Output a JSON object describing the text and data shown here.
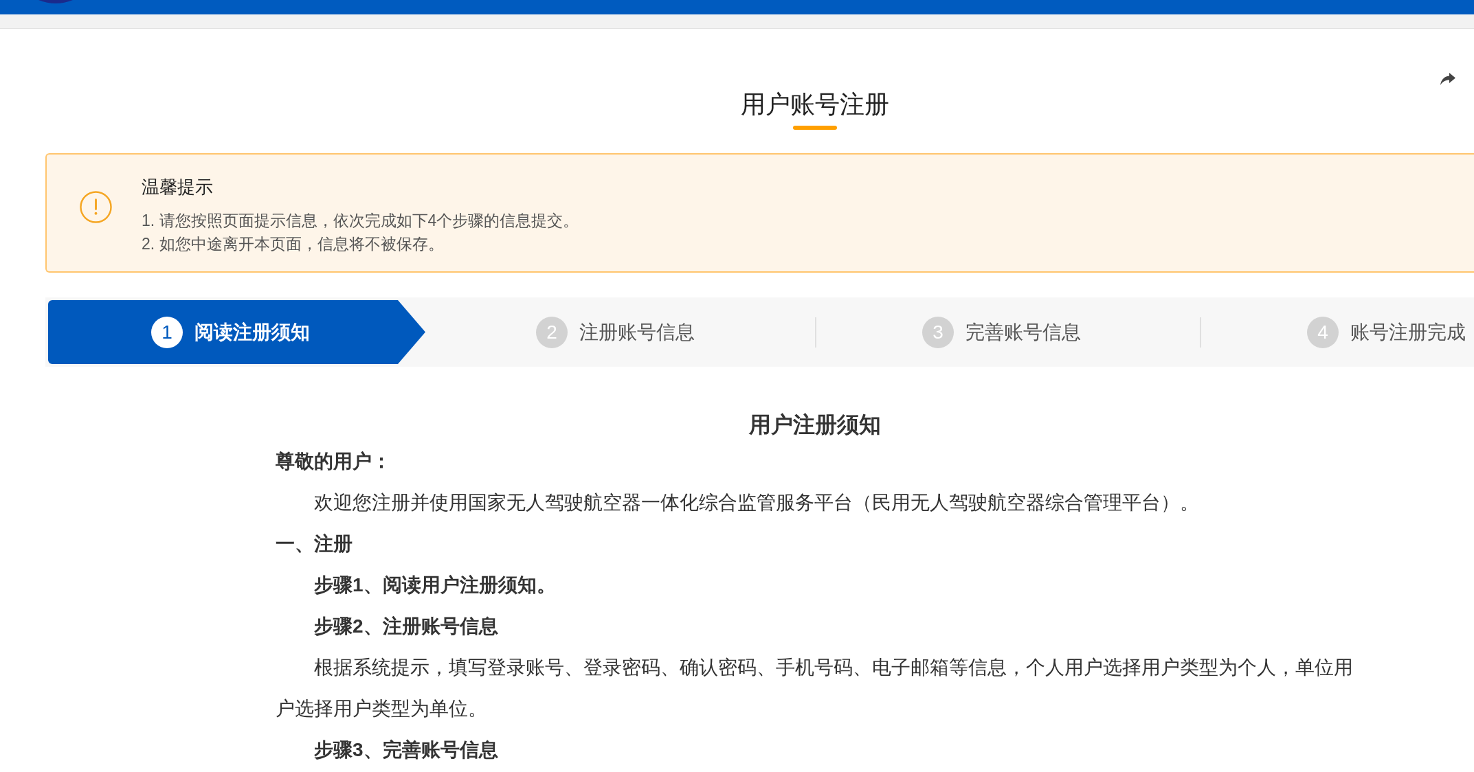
{
  "page_title": "用户账号注册",
  "notice": {
    "title": "温馨提示",
    "lines": [
      "1. 请您按照页面提示信息，依次完成如下4个步骤的信息提交。",
      "2. 如您中途离开本页面，信息将不被保存。"
    ]
  },
  "steps": [
    {
      "number": "1",
      "label": "阅读注册须知",
      "selected": true
    },
    {
      "number": "2",
      "label": "注册账号信息",
      "selected": false
    },
    {
      "number": "3",
      "label": "完善账号信息",
      "selected": false
    },
    {
      "number": "4",
      "label": "账号注册完成",
      "selected": false
    }
  ],
  "agreement": {
    "title": "用户注册须知",
    "paragraphs": [
      {
        "kind": "heading",
        "text": "尊敬的用户："
      },
      {
        "kind": "body",
        "text": "欢迎您注册并使用国家无人驾驶航空器一体化综合监管服务平台（民用无人驾驶航空器综合管理平台）。"
      },
      {
        "kind": "heading",
        "text": "一、注册"
      },
      {
        "kind": "subheading",
        "text": "步骤1、阅读用户注册须知。"
      },
      {
        "kind": "subheading",
        "text": "步骤2、注册账号信息"
      },
      {
        "kind": "body",
        "text": "根据系统提示，填写登录账号、登录密码、确认密码、手机号码、电子邮箱等信息，个人用户选择用户类型为个人，单位用户选择用户类型为单位。"
      },
      {
        "kind": "subheading",
        "text": "步骤3、完善账号信息"
      }
    ]
  }
}
